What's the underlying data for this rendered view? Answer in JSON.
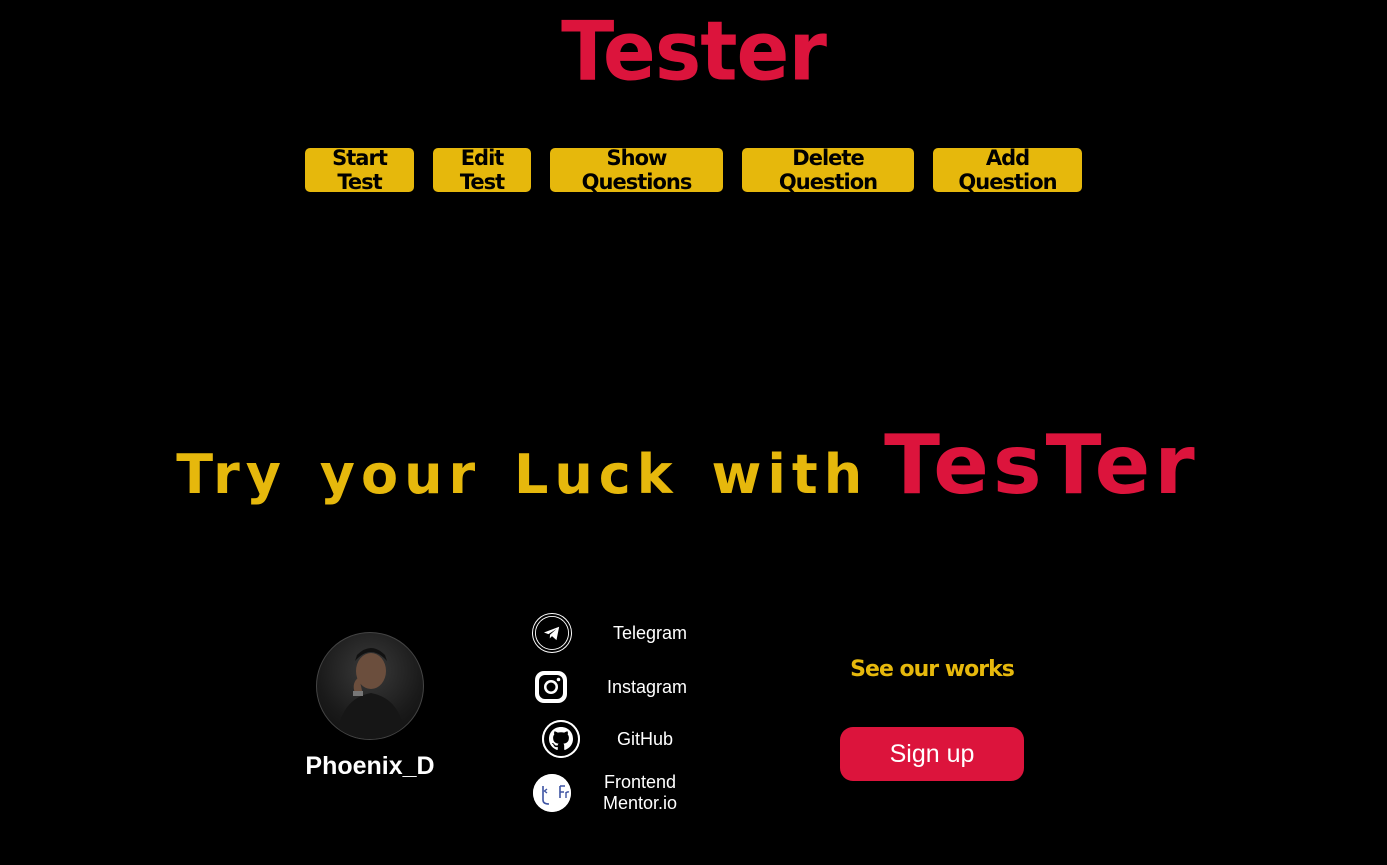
{
  "colors": {
    "accent_red": "#dc143c",
    "accent_yellow": "#e6b80c",
    "background": "#000000"
  },
  "header": {
    "title": "Tester"
  },
  "nav": {
    "buttons": [
      {
        "label": "Start Test"
      },
      {
        "label": "Edit Test"
      },
      {
        "label": "Show Questions"
      },
      {
        "label": "Delete Question"
      },
      {
        "label": "Add Question"
      }
    ]
  },
  "hero": {
    "text_left": "Try your Luck with",
    "text_right": "TesTer"
  },
  "footer": {
    "profile": {
      "name": "Phoenix_D",
      "avatar_icon": "profile-photo"
    },
    "socials": [
      {
        "label": "Telegram",
        "icon": "telegram-icon"
      },
      {
        "label": "Instagram",
        "icon": "instagram-icon"
      },
      {
        "label": "GitHub",
        "icon": "github-icon"
      },
      {
        "label": "Frontend Mentor.io",
        "icon": "frontend-mentor-icon"
      }
    ],
    "works_label": "See our works",
    "signup_label": "Sign up"
  }
}
